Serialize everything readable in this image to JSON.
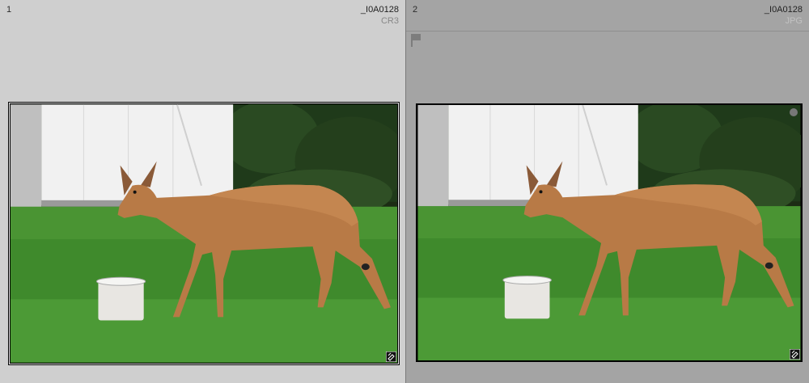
{
  "cells": [
    {
      "index": "1",
      "filename": "_I0A0128",
      "extension": "CR3"
    },
    {
      "index": "2",
      "filename": "_I0A0128",
      "extension": "JPG"
    }
  ],
  "icons": {
    "flag": "flag-icon",
    "edited_badge": "develop-adjust-icon",
    "color_label": "color-label-icon"
  },
  "colors": {
    "selected_cell_bg": "#cfcfcf",
    "cell_bg": "#a4a4a4"
  }
}
